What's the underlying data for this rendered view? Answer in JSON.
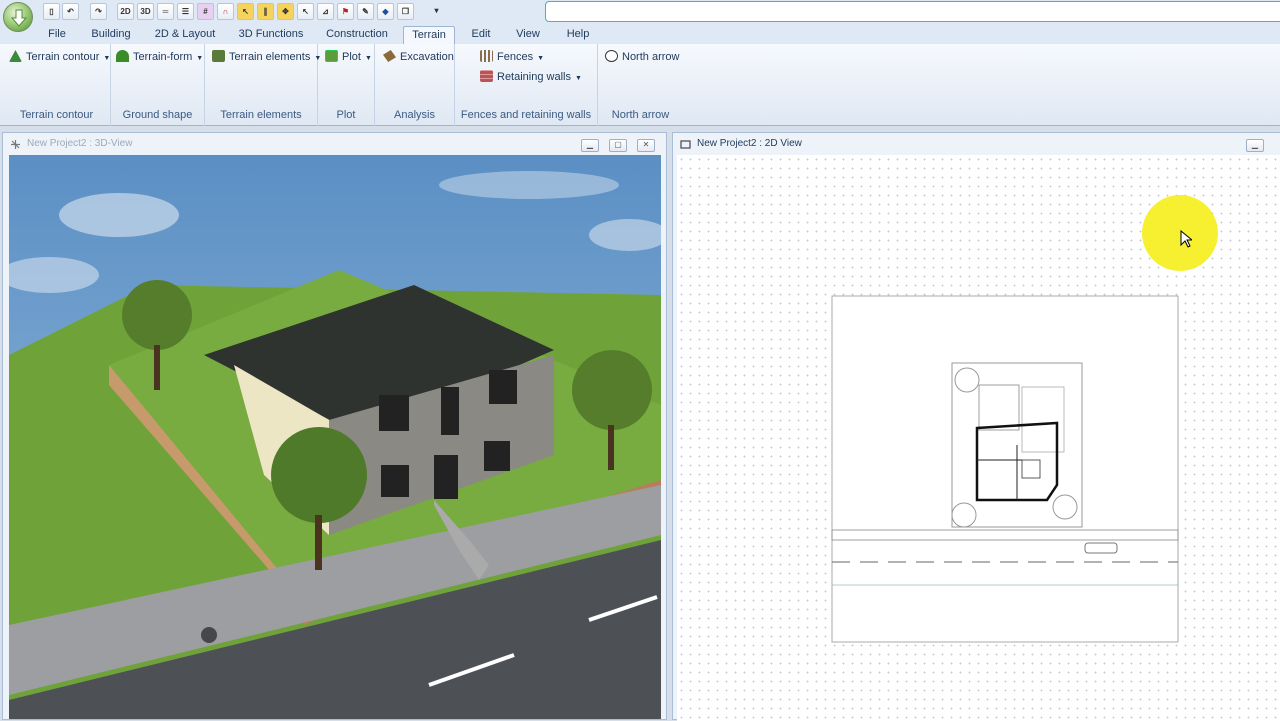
{
  "qat": {
    "search_value": "",
    "icons": [
      "new-icon",
      "undo-icon",
      "redo-icon",
      "view-2d-icon",
      "view-3d-icon",
      "wall-icon",
      "table-icon",
      "grid-icon",
      "magnet-icon",
      "columns-icon",
      "select-icon",
      "pointer-icon",
      "pick-icon",
      "measure-icon",
      "paint-icon",
      "pencil-icon",
      "copy-icon",
      "customize-icon"
    ],
    "btn_2d": "2D",
    "btn_3d": "3D"
  },
  "tabs": [
    "File",
    "Building",
    "2D & Layout",
    "3D Functions",
    "Construction",
    "Terrain",
    "Edit",
    "View",
    "Help"
  ],
  "active_tab": "Terrain",
  "ribbon": {
    "groups": [
      {
        "label": "Terrain contour",
        "buttons": [
          {
            "label": "Terrain contour",
            "icon": "terrain-contour-icon",
            "dropdown": true
          }
        ]
      },
      {
        "label": "Ground shape",
        "buttons": [
          {
            "label": "Terrain-form",
            "icon": "terrain-form-icon",
            "dropdown": true
          }
        ]
      },
      {
        "label": "Terrain elements",
        "buttons": [
          {
            "label": "Terrain elements",
            "icon": "terrain-elements-icon",
            "dropdown": true
          }
        ]
      },
      {
        "label": "Plot",
        "buttons": [
          {
            "label": "Plot",
            "icon": "plot-icon",
            "dropdown": true
          }
        ]
      },
      {
        "label": "Analysis",
        "buttons": [
          {
            "label": "Excavation",
            "icon": "excavation-icon",
            "dropdown": false
          }
        ]
      },
      {
        "label": "Fences and retaining walls",
        "buttons": [
          {
            "label": "Fences",
            "icon": "fence-icon",
            "dropdown": true
          },
          {
            "label": "Retaining walls",
            "icon": "retaining-wall-icon",
            "dropdown": true
          }
        ]
      },
      {
        "label": "North arrow",
        "buttons": [
          {
            "label": "North arrow",
            "icon": "north-arrow-icon",
            "dropdown": false
          }
        ]
      }
    ]
  },
  "windows": {
    "view3d": {
      "title": "New Project2 : 3D-View"
    },
    "view2d": {
      "title": "New Project2 : 2D View"
    }
  },
  "colors": {
    "accent": "#49b7a0",
    "ribbon": "#dfe8f3",
    "sky": "#5b93c9",
    "grass": "#6fa33a",
    "roof": "#2f3330",
    "wall_gray": "#8b8984",
    "wall_cream": "#ece6c4",
    "road": "#4d5156",
    "highlight": "#f5ef1e"
  }
}
